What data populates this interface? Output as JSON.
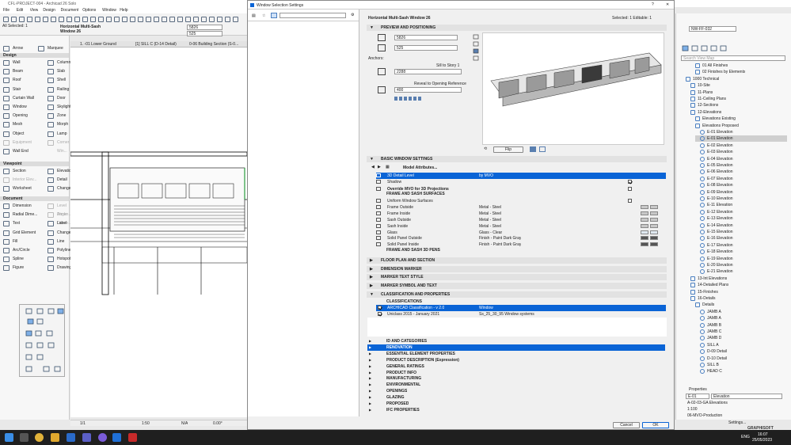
{
  "app": {
    "title": "CFL-PROJECT-004 - Archicad 26 Solo",
    "menus": [
      "File",
      "Edit",
      "View",
      "Design",
      "Document",
      "Options",
      "Window",
      "Help"
    ],
    "selected_label": "All Selected: 1",
    "info_title": "Horizontal Multi-Sash",
    "info_subtitle": "Window 26",
    "width_field": "5826",
    "height_field": "525",
    "layer_field": "NW-FF-032"
  },
  "toolbox": {
    "arrow": "Arrow",
    "marquee": "Marquee",
    "design_header": "Design",
    "design_items": [
      "Wall",
      "Column",
      "Beam",
      "Slab",
      "Roof",
      "Shell",
      "Stair",
      "Railing",
      "Curtain Wall",
      "Door",
      "Window",
      "Skylight",
      "Opening",
      "Zone",
      "Mesh",
      "Morph",
      "Object",
      "Lamp",
      "Equipment",
      "Corner Win...",
      "Wall End"
    ],
    "viewpoint_header": "Viewpoint",
    "viewpoint_items": [
      "Section",
      "Elevation",
      "Interior Elev...",
      "Detail",
      "Worksheet",
      "Change"
    ],
    "document_header": "Document",
    "document_items": [
      "Dimension",
      "Level Dimen...",
      "Radial Dime...",
      "Angle Dimen...",
      "Text",
      "Label",
      "Grid Element",
      "Change",
      "Fill",
      "Line",
      "Arc/Circle",
      "Polyline",
      "Spline",
      "Hotspot",
      "Figure",
      "Drawing"
    ]
  },
  "drawing_tabs": [
    "1. -01 Lower Ground",
    "[1] SILL C (D-14 Detail)",
    "0-06 Building Section (S-0..."
  ],
  "statusbar": {
    "zoom": "1:50",
    "scale": "N/A",
    "angle": "0.00°",
    "page": "1/1"
  },
  "dialog": {
    "title": "Window Selection Settings",
    "element_name": "Horizontal Multi-Sash Window 26",
    "selected_info": "Selected: 1 Editable: 1",
    "sections": {
      "preview": "PREVIEW AND POSITIONING",
      "basic": "BASIC WINDOW SETTINGS",
      "floorplan": "FLOOR PLAN AND SECTION",
      "dim_marker": "DIMENSION MARKER",
      "marker_text": "MARKER TEXT STYLE",
      "marker_symbol": "MARKER SYMBOL AND TEXT",
      "classification": "CLASSIFICATION AND PROPERTIES"
    },
    "preview": {
      "width": "5826",
      "height": "525",
      "anchors_label": "Anchors:",
      "sill_label": "Sill to Story 1",
      "sill_value": "2288",
      "reveal_label": "Reveal to Opening Reference",
      "reveal_value": "400",
      "flip_label": "Flip"
    },
    "basic": {
      "model_attributes": "Model Attributes...",
      "rows": [
        {
          "name": "3D Detail Level",
          "value": "by MVO"
        },
        {
          "name": "Shadow",
          "value": ""
        },
        {
          "name": "Override MVO for 3D Projections",
          "value": ""
        }
      ],
      "frame_sash_header": "FRAME AND SASH SURFACES",
      "surface_rows": [
        {
          "name": "Uniform Window Surfaces",
          "value": ""
        },
        {
          "name": "Frame Outside",
          "value": "Metal - Steel"
        },
        {
          "name": "Frame Inside",
          "value": "Metal - Steel"
        },
        {
          "name": "Sash Outside",
          "value": "Metal - Steel"
        },
        {
          "name": "Sash Inside",
          "value": "Metal - Steel"
        },
        {
          "name": "Glass",
          "value": "Glass - Clear"
        },
        {
          "name": "Solid Panel Outside",
          "value": "Finish - Paint Dark Gray"
        },
        {
          "name": "Solid Panel Inside",
          "value": "Finish - Paint Dark Gray"
        }
      ],
      "frame_sash_pens": "FRAME AND SASH 3D PENS"
    },
    "classification": {
      "header": "CLASSIFICATIONS",
      "rows": [
        {
          "name": "ARCHICAD Classification - v 2.0",
          "value": "Window"
        },
        {
          "name": "Uniclass 2015 - January 2021",
          "value": "Ss_25_30_95 Window systems"
        }
      ],
      "groups": [
        "ID AND CATEGORIES",
        "RENOVATION",
        "ESSENTIAL ELEMENT PROPERTIES",
        "PRODUCT DESCRIPTION (Expression)",
        "GENERAL RATINGS",
        "PRODUCT INFO",
        "MANUFACTURING",
        "ENVIRONMENTAL",
        "OPENINGS",
        "GLAZING",
        "PROPOSED",
        "IFC PROPERTIES"
      ]
    },
    "cancel": "Cancel",
    "ok": "OK"
  },
  "navigator": {
    "search_placeholder": "Search View Map",
    "items": [
      {
        "label": "01 All Finishes",
        "indent": 3
      },
      {
        "label": "02 Finishes by Elements",
        "indent": 3
      },
      {
        "label": "1000 Technical",
        "indent": 1
      },
      {
        "label": "10-Site",
        "indent": 2
      },
      {
        "label": "11-Plans",
        "indent": 2
      },
      {
        "label": "11-Ceiling Plans",
        "indent": 2
      },
      {
        "label": "12-Sections",
        "indent": 2
      },
      {
        "label": "12-Elevations",
        "indent": 2
      },
      {
        "label": "Elevations Existing",
        "indent": 3
      },
      {
        "label": "Elevations Proposed",
        "indent": 3
      },
      {
        "label": "E-01 Elevation",
        "indent": 4
      },
      {
        "label": "E-01 Elevation",
        "indent": 4
      },
      {
        "label": "E-02 Elevation",
        "indent": 4
      },
      {
        "label": "E-03 Elevation",
        "indent": 4
      },
      {
        "label": "E-04 Elevation",
        "indent": 4
      },
      {
        "label": "E-05 Elevation",
        "indent": 4
      },
      {
        "label": "E-06 Elevation",
        "indent": 4
      },
      {
        "label": "E-07 Elevation",
        "indent": 4
      },
      {
        "label": "E-08 Elevation",
        "indent": 4
      },
      {
        "label": "E-09 Elevation",
        "indent": 4
      },
      {
        "label": "E-10 Elevation",
        "indent": 4
      },
      {
        "label": "E-11 Elevation",
        "indent": 4
      },
      {
        "label": "E-12 Elevation",
        "indent": 4
      },
      {
        "label": "E-13 Elevation",
        "indent": 4
      },
      {
        "label": "E-14 Elevation",
        "indent": 4
      },
      {
        "label": "E-15 Elevation",
        "indent": 4
      },
      {
        "label": "E-16 Elevation",
        "indent": 4
      },
      {
        "label": "E-17 Elevation",
        "indent": 4
      },
      {
        "label": "E-18 Elevation",
        "indent": 4
      },
      {
        "label": "E-19 Elevation",
        "indent": 4
      },
      {
        "label": "E-20 Elevation",
        "indent": 4
      },
      {
        "label": "E-21 Elevation",
        "indent": 4
      },
      {
        "label": "13-Int Elevations",
        "indent": 2
      },
      {
        "label": "14-Detailed Plans",
        "indent": 2
      },
      {
        "label": "15-Finishes",
        "indent": 2
      },
      {
        "label": "16-Details",
        "indent": 2
      },
      {
        "label": "Details",
        "indent": 3
      },
      {
        "label": "JAMB A",
        "indent": 4
      },
      {
        "label": "JAMB A",
        "indent": 4
      },
      {
        "label": "JAMB B",
        "indent": 4
      },
      {
        "label": "JAMB C",
        "indent": 4
      },
      {
        "label": "JAMB D",
        "indent": 4
      },
      {
        "label": "SILL A",
        "indent": 4
      },
      {
        "label": "D-09 Detail",
        "indent": 4
      },
      {
        "label": "D-10 Detail",
        "indent": 4
      },
      {
        "label": "SILL B",
        "indent": 4
      },
      {
        "label": "HEAD C",
        "indent": 4
      }
    ],
    "properties_header": "Properties",
    "prop_id": "E-01",
    "prop_name": "Elevation",
    "prop_rows": [
      "A-02-03-GA Elevations",
      "1:100",
      "06-MVO-Production"
    ],
    "settings_btn": "Settings...",
    "brand": "GRAPHISOFT"
  },
  "taskbar": {
    "lang": "ENG",
    "time": "16:07",
    "date": "25/05/2023"
  }
}
